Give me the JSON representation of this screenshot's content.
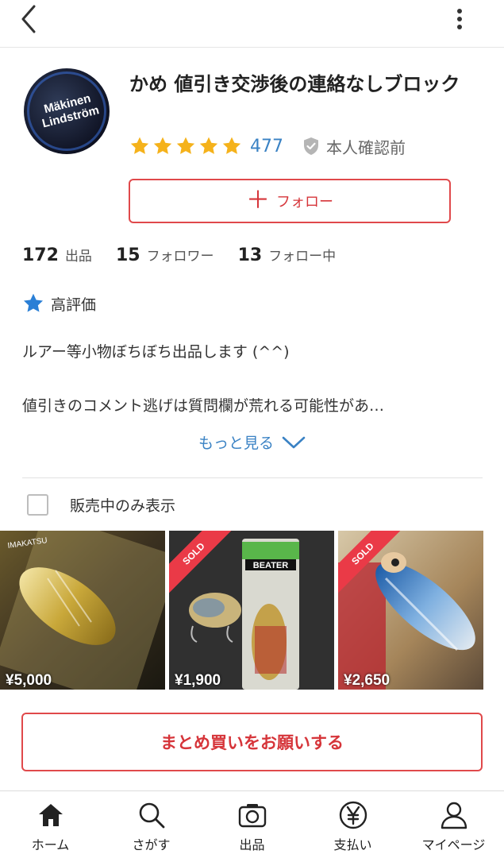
{
  "profile": {
    "avatar_text": "Mäkinen Lindström",
    "name": "かめ 値引き交渉後の連絡なしブロック",
    "review_count": "477",
    "star_rating": 5,
    "verification_status": "本人確認前"
  },
  "follow_button": {
    "plus": "＋",
    "label": "フォロー"
  },
  "stats": [
    {
      "value": "172",
      "label": "出品"
    },
    {
      "value": "15",
      "label": "フォロワー"
    },
    {
      "value": "13",
      "label": "フォロー中"
    }
  ],
  "badge": {
    "label": "高評価"
  },
  "bio": {
    "line1": "ルアー等小物ぼちぼち出品します (^^)",
    "line2": "値引きのコメント逃げは質問欄が荒れる可能性があ…",
    "more_label": "もっと見る"
  },
  "filter": {
    "label": "販売中のみ表示",
    "checked": false
  },
  "items": [
    {
      "price": "¥5,000",
      "sold": false,
      "brand_text": "IMAKATSU"
    },
    {
      "price": "¥1,900",
      "sold": true,
      "sold_label": "SOLD",
      "package_text": "BEATER"
    },
    {
      "price": "¥2,650",
      "sold": true,
      "sold_label": "SOLD"
    }
  ],
  "bulk_button": {
    "label": "まとめ買いをお願いする"
  },
  "bottom_nav": [
    {
      "icon": "home-icon",
      "label": "ホーム"
    },
    {
      "icon": "search-icon",
      "label": "さがす"
    },
    {
      "icon": "camera-icon",
      "label": "出品"
    },
    {
      "icon": "yen-icon",
      "label": "支払い"
    },
    {
      "icon": "user-icon",
      "label": "マイページ"
    }
  ],
  "colors": {
    "accent_red": "#e0494b",
    "link_blue": "#3a82c4",
    "star_gold": "#f5b21b",
    "badge_blue": "#2a7fd6",
    "sold_red": "#ea3a47"
  }
}
